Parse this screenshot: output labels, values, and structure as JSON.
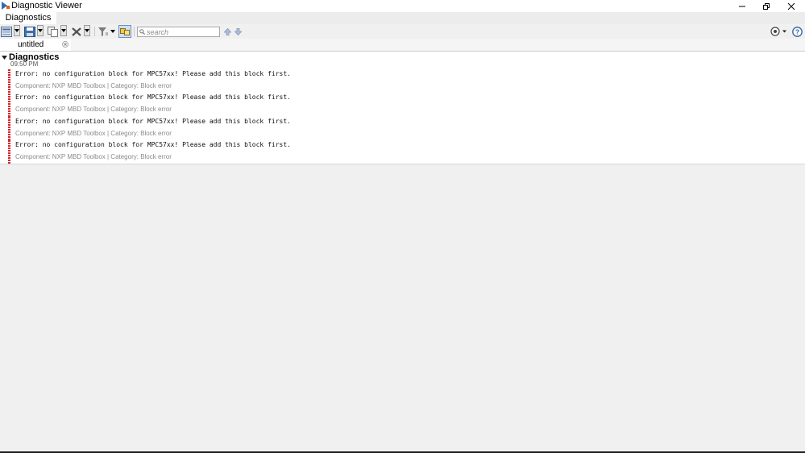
{
  "window": {
    "title": "Diagnostic Viewer",
    "controls": {
      "minimize": "minimize-icon",
      "maximize": "restore-icon",
      "close": "close-icon"
    }
  },
  "main_tab": {
    "label": "Diagnostics"
  },
  "toolbar": {
    "buttons": [
      "view-icon",
      "save-icon",
      "copy-icon",
      "clear-icon",
      "filter-icon",
      "highlight-icon"
    ],
    "search_placeholder": "search",
    "nav": [
      "previous-arrow-icon",
      "next-arrow-icon"
    ],
    "right": [
      "settings-icon",
      "help-icon"
    ]
  },
  "doc_tab": {
    "label": "untitled"
  },
  "group": {
    "title": "Diagnostics",
    "time": "09:50 PM"
  },
  "messages": [
    {
      "text": "Error: no configuration block for MPC57xx! Please add this block first.",
      "meta": "Component:  NXP MBD Toolbox | Category:  Block error"
    },
    {
      "text": "Error: no configuration block for MPC57xx! Please add this block first.",
      "meta": "Component:  NXP MBD Toolbox | Category:  Block error"
    },
    {
      "text": "Error: no configuration block for MPC57xx! Please add this block first.",
      "meta": "Component:  NXP MBD Toolbox | Category:  Block error"
    },
    {
      "text": "Error: no configuration block for MPC57xx! Please add this block first.",
      "meta": "Component:  NXP MBD Toolbox | Category:  Block error"
    }
  ],
  "colors": {
    "error_stripe": "#d8262b",
    "meta_text": "#8a8a8a"
  }
}
